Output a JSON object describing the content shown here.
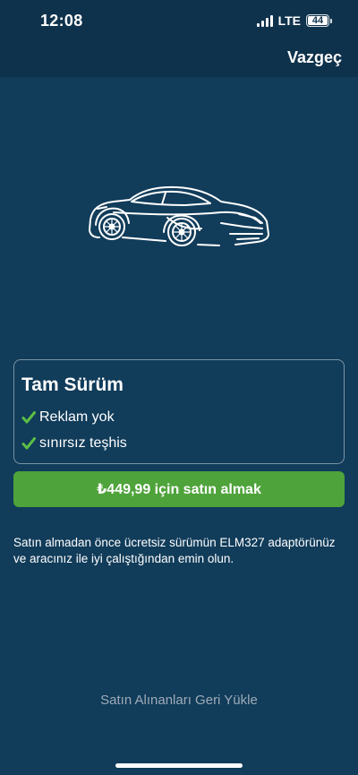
{
  "status_bar": {
    "time": "12:08",
    "network": "LTE",
    "battery": "44"
  },
  "header": {
    "cancel_label": "Vazgeç"
  },
  "hero": {
    "icon": "sports-car-icon"
  },
  "plan": {
    "title": "Tam Sürüm",
    "features": [
      "Reklam yok",
      "sınırsız teşhis"
    ]
  },
  "purchase": {
    "button_label": "₺449,99 için satın almak"
  },
  "note": "Satın almadan önce ücretsiz sürümün ELM327 adaptörünüz ve aracınız ile iyi çalıştığından emin olun.",
  "restore_label": "Satın Alınanları Geri Yükle",
  "colors": {
    "background": "#113c5a",
    "top_bar": "#0f324c",
    "accent_green": "#4fa33b",
    "check_green": "#5cbf45"
  }
}
